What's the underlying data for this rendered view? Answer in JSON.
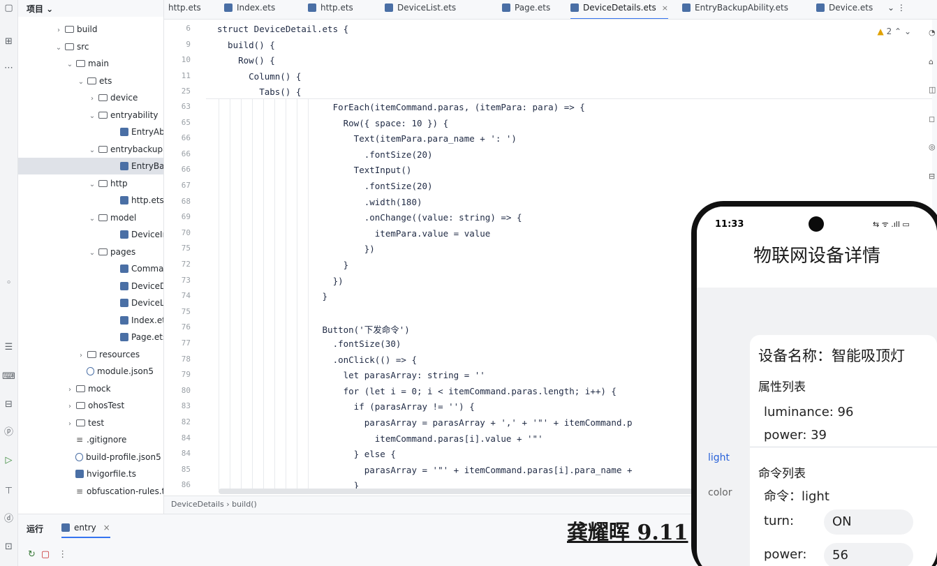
{
  "tree": {
    "header": "项目 ⌄",
    "rows": [
      {
        "chev": "›",
        "label": "build",
        "kind": "folder"
      },
      {
        "chev": "⌄",
        "label": "src",
        "kind": "folder"
      },
      {
        "chev": "⌄",
        "label": "main",
        "kind": "folder"
      },
      {
        "chev": "⌄",
        "label": "ets",
        "kind": "folder"
      },
      {
        "chev": "›",
        "label": "device",
        "kind": "folder"
      },
      {
        "chev": "⌄",
        "label": "entryability",
        "kind": "folder"
      },
      {
        "chev": "",
        "label": "EntryAbility",
        "kind": "file"
      },
      {
        "chev": "⌄",
        "label": "entrybackupability",
        "kind": "folder"
      },
      {
        "chev": "",
        "label": "EntryBackupAbility",
        "kind": "file"
      },
      {
        "chev": "⌄",
        "label": "http",
        "kind": "folder"
      },
      {
        "chev": "",
        "label": "http.ets",
        "kind": "file"
      },
      {
        "chev": "⌄",
        "label": "model",
        "kind": "folder"
      },
      {
        "chev": "",
        "label": "DeviceInfo",
        "kind": "file"
      },
      {
        "chev": "⌄",
        "label": "pages",
        "kind": "folder"
      },
      {
        "chev": "",
        "label": "Command",
        "kind": "file"
      },
      {
        "chev": "",
        "label": "DeviceDetails",
        "kind": "file"
      },
      {
        "chev": "",
        "label": "DeviceList",
        "kind": "file"
      },
      {
        "chev": "",
        "label": "Index.ets",
        "kind": "file"
      },
      {
        "chev": "",
        "label": "Page.ets",
        "kind": "file"
      },
      {
        "chev": "›",
        "label": "resources",
        "kind": "folder"
      },
      {
        "chev": "",
        "label": "module.json5",
        "kind": "json"
      },
      {
        "chev": "›",
        "label": "mock",
        "kind": "folder"
      },
      {
        "chev": "›",
        "label": "ohosTest",
        "kind": "folder"
      },
      {
        "chev": "›",
        "label": "test",
        "kind": "folder"
      },
      {
        "chev": "",
        "label": ".gitignore",
        "kind": "plain"
      },
      {
        "chev": "",
        "label": "build-profile.json5",
        "kind": "json"
      },
      {
        "chev": "",
        "label": "hvigorfile.ts",
        "kind": "file"
      },
      {
        "chev": "",
        "label": "obfuscation-rules.txt",
        "kind": "plain"
      }
    ]
  },
  "tabs": [
    {
      "label": "http.ets"
    },
    {
      "label": "Index.ets"
    },
    {
      "label": "http.ets"
    },
    {
      "label": "DeviceList.ets"
    },
    {
      "label": "Page.ets"
    },
    {
      "label": "DeviceDetails.ets",
      "active": true,
      "close": "×"
    },
    {
      "label": "EntryBackupAbility.ets"
    },
    {
      "label": "Device.ets"
    }
  ],
  "tab_overflow": "⌄  ⋮",
  "editor": {
    "warning": "2",
    "sticky": [
      {
        "ln": "6",
        "code": "struct DeviceDetail.ets {"
      },
      {
        "ln": "9",
        "code": "  build() {"
      },
      {
        "ln": "10",
        "code": "    Row() {"
      },
      {
        "ln": "11",
        "code": "      Column() {"
      },
      {
        "ln": "25",
        "code": "        Tabs() {"
      }
    ],
    "lines": [
      {
        "ln": "63",
        "code": "                      ForEach(itemCommand.paras, (itemPara: para) => {"
      },
      {
        "ln": "65",
        "code": "                        Row({ space: 10 }) {"
      },
      {
        "ln": "66",
        "code": "                          Text(itemPara.para_name + ': ')"
      },
      {
        "ln": "66",
        "code": "                            .fontSize(20)"
      },
      {
        "ln": "66",
        "code": "                          TextInput()"
      },
      {
        "ln": "67",
        "code": "                            .fontSize(20)"
      },
      {
        "ln": "68",
        "code": "                            .width(180)"
      },
      {
        "ln": "69",
        "code": "                            .onChange((value: string) => {"
      },
      {
        "ln": "70",
        "code": "                              itemPara.value = value"
      },
      {
        "ln": "75",
        "code": "                            })"
      },
      {
        "ln": "72",
        "code": "                        }"
      },
      {
        "ln": "73",
        "code": "                      })"
      },
      {
        "ln": "74",
        "code": "                    }"
      },
      {
        "ln": "75",
        "code": ""
      },
      {
        "ln": "76",
        "code": "                    Button('下发命令')"
      },
      {
        "ln": "77",
        "code": "                      .fontSize(30)"
      },
      {
        "ln": "78",
        "code": "                      .onClick(() => {"
      },
      {
        "ln": "79",
        "code": "                        let parasArray: string = ''"
      },
      {
        "ln": "80",
        "code": "                        for (let i = 0; i < itemCommand.paras.length; i++) {"
      },
      {
        "ln": "83",
        "code": "                          if (parasArray != '') {"
      },
      {
        "ln": "82",
        "code": "                            parasArray = parasArray + ',' + '\"' + itemCommand.p"
      },
      {
        "ln": "84",
        "code": "                              itemCommand.paras[i].value + '\"'"
      },
      {
        "ln": "84",
        "code": "                          } else {"
      },
      {
        "ln": "85",
        "code": "                            parasArray = '\"' + itemCommand.paras[i].para_name +"
      },
      {
        "ln": "86",
        "code": "                          }"
      }
    ]
  },
  "breadcrumb": "DeviceDetails  ›  build()",
  "run": {
    "tab_label": "运行",
    "entry_label": "entry",
    "close": "×"
  },
  "signature": "龚耀晖  9.11",
  "phone": {
    "time": "11:33",
    "status_icons": "⇆ ᯤ .ıll ▭",
    "title": "物联网设备详情",
    "side_tabs": [
      "light",
      "color"
    ],
    "device_name": "设备名称：智能吸顶灯",
    "props_title": "属性列表",
    "props": [
      "luminance:  96",
      "power:  39"
    ],
    "cmds_title": "命令列表",
    "cmd_name": "命令：light",
    "cmd_params": [
      {
        "name": "turn:",
        "value": "ON"
      },
      {
        "name": "power:",
        "value": "56"
      }
    ]
  },
  "colors": {
    "accent": "#3574f0",
    "phone_tab_active": "#2962d9",
    "warning": "#e0a100"
  }
}
